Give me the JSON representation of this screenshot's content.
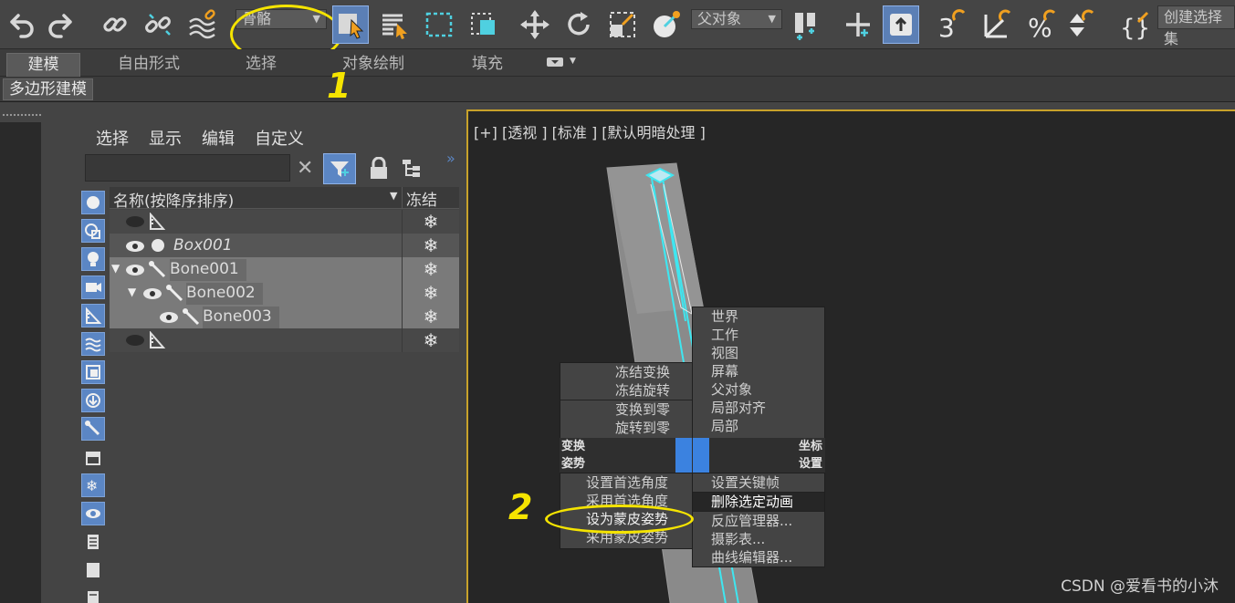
{
  "toolbar": {
    "selection_filter": "骨骼",
    "reference_coord": "父对象",
    "named_selection_placeholder": "创建选择集",
    "icons": [
      "undo-icon",
      "redo-icon",
      "link-icon",
      "unlink-icon",
      "bind-spacewarp-icon",
      "select-object-icon",
      "select-by-name-icon",
      "rect-selection-icon",
      "window-crossing-icon",
      "move-icon",
      "rotate-icon",
      "scale-icon",
      "select-manipulate-icon",
      "keyboard-shortcut-icon",
      "snap-toggle-icon",
      "angle-snap-icon",
      "percent-snap-icon",
      "spinner-snap-icon",
      "edit-named-sets-icon"
    ]
  },
  "annotations": {
    "one": "1",
    "two": "2"
  },
  "ribbon": {
    "tabs": [
      "建模",
      "自由形式",
      "选择",
      "对象绘制",
      "填充"
    ],
    "active_tab": "建模",
    "sub_tab": "多边形建模"
  },
  "scene_explorer": {
    "menu": [
      "选择",
      "显示",
      "编辑",
      "自定义"
    ],
    "search_value": "",
    "columns": {
      "name": "名称(按降序排序)",
      "freeze": "冻结"
    },
    "rows": [
      {
        "name": "",
        "type": "helper"
      },
      {
        "name": "Box001",
        "type": "geometry"
      },
      {
        "name": "Bone001",
        "type": "bone"
      },
      {
        "name": "Bone002",
        "type": "bone"
      },
      {
        "name": "Bone003",
        "type": "bone"
      },
      {
        "name": "",
        "type": "helper"
      }
    ],
    "freeze_glyph": "❄"
  },
  "viewport": {
    "label": "[+] [透视 ] [标准 ] [默认明暗处理 ]"
  },
  "quad_menu": {
    "top_left": [
      "冻结变换",
      "冻结旋转",
      "变换到零",
      "旋转到零"
    ],
    "top_right": [
      "世界",
      "工作",
      "视图",
      "屏幕",
      "父对象",
      "局部对齐",
      "局部"
    ],
    "headers": {
      "left_top": "变换",
      "right_top": "坐标",
      "left_bottom": "姿势",
      "right_bottom": "设置"
    },
    "bottom_left": [
      "设置首选角度",
      "采用首选角度",
      "设为蒙皮姿势",
      "采用蒙皮姿势"
    ],
    "bottom_right": [
      "设置关键帧",
      "删除选定动画",
      "反应管理器...",
      "摄影表...",
      "曲线编辑器..."
    ]
  },
  "watermark": "CSDN @爱看书的小沐",
  "colors": {
    "accent": "#5b86c4",
    "annotation": "#f5e400",
    "bone_cyan": "#3fe6f0",
    "viewport_border": "#c8a22a"
  }
}
